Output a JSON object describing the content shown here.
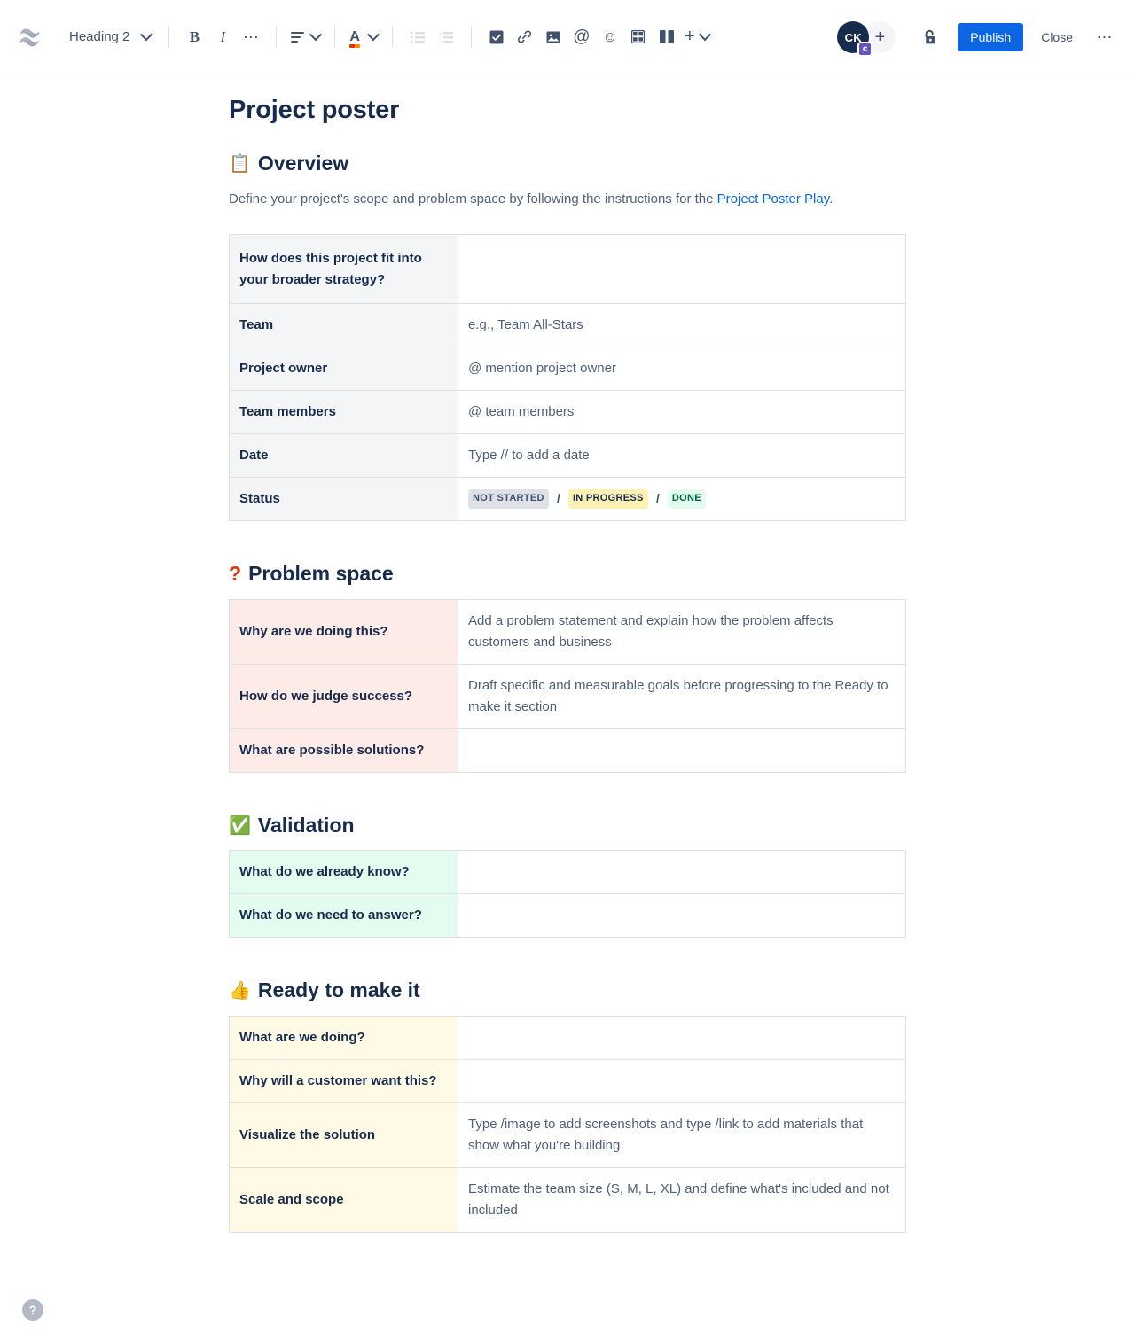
{
  "toolbar": {
    "logo_name": "confluence-logo",
    "style_select": {
      "value": "Heading 2"
    },
    "bold_label": "B",
    "italic_label": "I",
    "more_formatting_label": "…",
    "align_label": "align-left-icon",
    "text_color_label": "A",
    "bullet_list_label": "bullet-list-icon",
    "numbered_list_label": "numbered-list-icon",
    "task_label": "task-checkbox-icon",
    "link_label": "link-icon",
    "image_label": "image-icon",
    "mention_label": "@",
    "emoji_label": "☺",
    "table_label": "table-icon",
    "layout_label": "layout-columns-icon",
    "insert_label": "+",
    "avatar_initials": "CK",
    "avatar_badge": "c",
    "add_person_label": "+",
    "restrictions_label": "unlocked-padlock-icon",
    "publish_label": "Publish",
    "close_label": "Close",
    "more_label": "…"
  },
  "document": {
    "title": "Project poster"
  },
  "sections": {
    "overview": {
      "emoji": "📋",
      "heading": "Overview",
      "intro_before": "Define your project's scope and problem space by following the instructions for the ",
      "intro_link": "Project Poster Play",
      "intro_after": ".",
      "rows": [
        {
          "label": "How does this project fit into your broader strategy?",
          "value": ""
        },
        {
          "label": "Team",
          "value": "e.g., Team All-Stars"
        },
        {
          "label": "Project owner",
          "value": "@ mention project owner"
        },
        {
          "label": "Team members",
          "value": "@ team members"
        },
        {
          "label": "Date",
          "value": "Type // to add a date"
        },
        {
          "label": "Status",
          "value": ""
        }
      ],
      "status": {
        "not_started": "NOT STARTED",
        "in_progress": "IN PROGRESS",
        "done": "DONE",
        "separator": "/"
      }
    },
    "problem_space": {
      "emoji": "?",
      "heading": "Problem space",
      "rows": [
        {
          "label": "Why are we doing this?",
          "value": "Add a problem statement and explain how the problem affects customers and business"
        },
        {
          "label": "How do we judge success?",
          "value": "Draft specific and measurable goals before progressing to the Ready to make it section"
        },
        {
          "label": "What are possible solutions?",
          "value": ""
        }
      ]
    },
    "validation": {
      "emoji": "✅",
      "heading": "Validation",
      "rows": [
        {
          "label": "What do we already know?",
          "value": ""
        },
        {
          "label": "What do we need to answer?",
          "value": ""
        }
      ]
    },
    "ready_to_make_it": {
      "emoji": "👍",
      "heading": "Ready to make it",
      "rows": [
        {
          "label": "What are we doing?",
          "value": ""
        },
        {
          "label": "Why will a customer want this?",
          "value": ""
        },
        {
          "label": "Visualize the solution",
          "value": "Type /image to add screenshots and type /link to add materials that show what you're building"
        },
        {
          "label": "Scale and scope",
          "value": "Estimate the team size (S, M, L, XL) and define what's included and not included"
        }
      ]
    }
  },
  "help": {
    "label": "?"
  },
  "colors": {
    "brand_blue": "#0c66e4",
    "text_dark": "#172b4d",
    "text_muted": "#505f79",
    "grey_row": "#f4f5f7",
    "pink_row": "#fdebe7",
    "green_row": "#e3fcef",
    "yellow_row": "#fffae6",
    "border": "#dfe1e6",
    "avatar_bg": "#172b4d",
    "badge_purple": "#6554c0"
  }
}
